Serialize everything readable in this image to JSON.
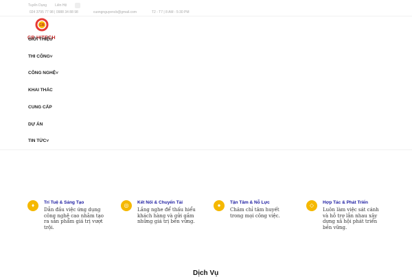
{
  "topbar": {
    "links": [
      "Tuyển Dụng",
      "Liên Hệ"
    ],
    "phone": "024 3795 77 98 | 0988 34 88 98",
    "email": "cuongnguyencb@gmail.com",
    "hours": "T2 - T7 | 8 AM - 5:30 PM"
  },
  "logo": {
    "brand": "CB HITECH"
  },
  "nav": [
    "GIỚI THIỆU",
    "THI CÔNG",
    "CÔNG NGHỆ",
    "KHAI THÁC",
    "CUNG CẤP",
    "DỰ ÁN",
    "TIN TỨC"
  ],
  "features": [
    {
      "icon": "lightbulb-icon",
      "title": "Trí Tuệ & Sáng Tạo",
      "desc": "Dẫn đầu việc ứng dụng công nghệ cao nhằm tạo ra sản phẩm giá trị vượt trội."
    },
    {
      "icon": "connect-icon",
      "title": "Kết Nối & Chuyển Tải",
      "desc": "Lắng nghe để thấu hiểu khách hàng và gửi gắm những giá trị bền vững."
    },
    {
      "icon": "person-icon",
      "title": "Tận Tâm & Nỗ Lực",
      "desc": "Chăm chỉ tâm huyết trong mọi công việc."
    },
    {
      "icon": "handshake-icon",
      "title": "Hợp Tác & Phát Triển",
      "desc": "Luôn làm việc sát cánh và hỗ trợ lẫn nhau xây dựng xã hội phát triển bền vững."
    }
  ],
  "section_title": "Dịch Vụ"
}
